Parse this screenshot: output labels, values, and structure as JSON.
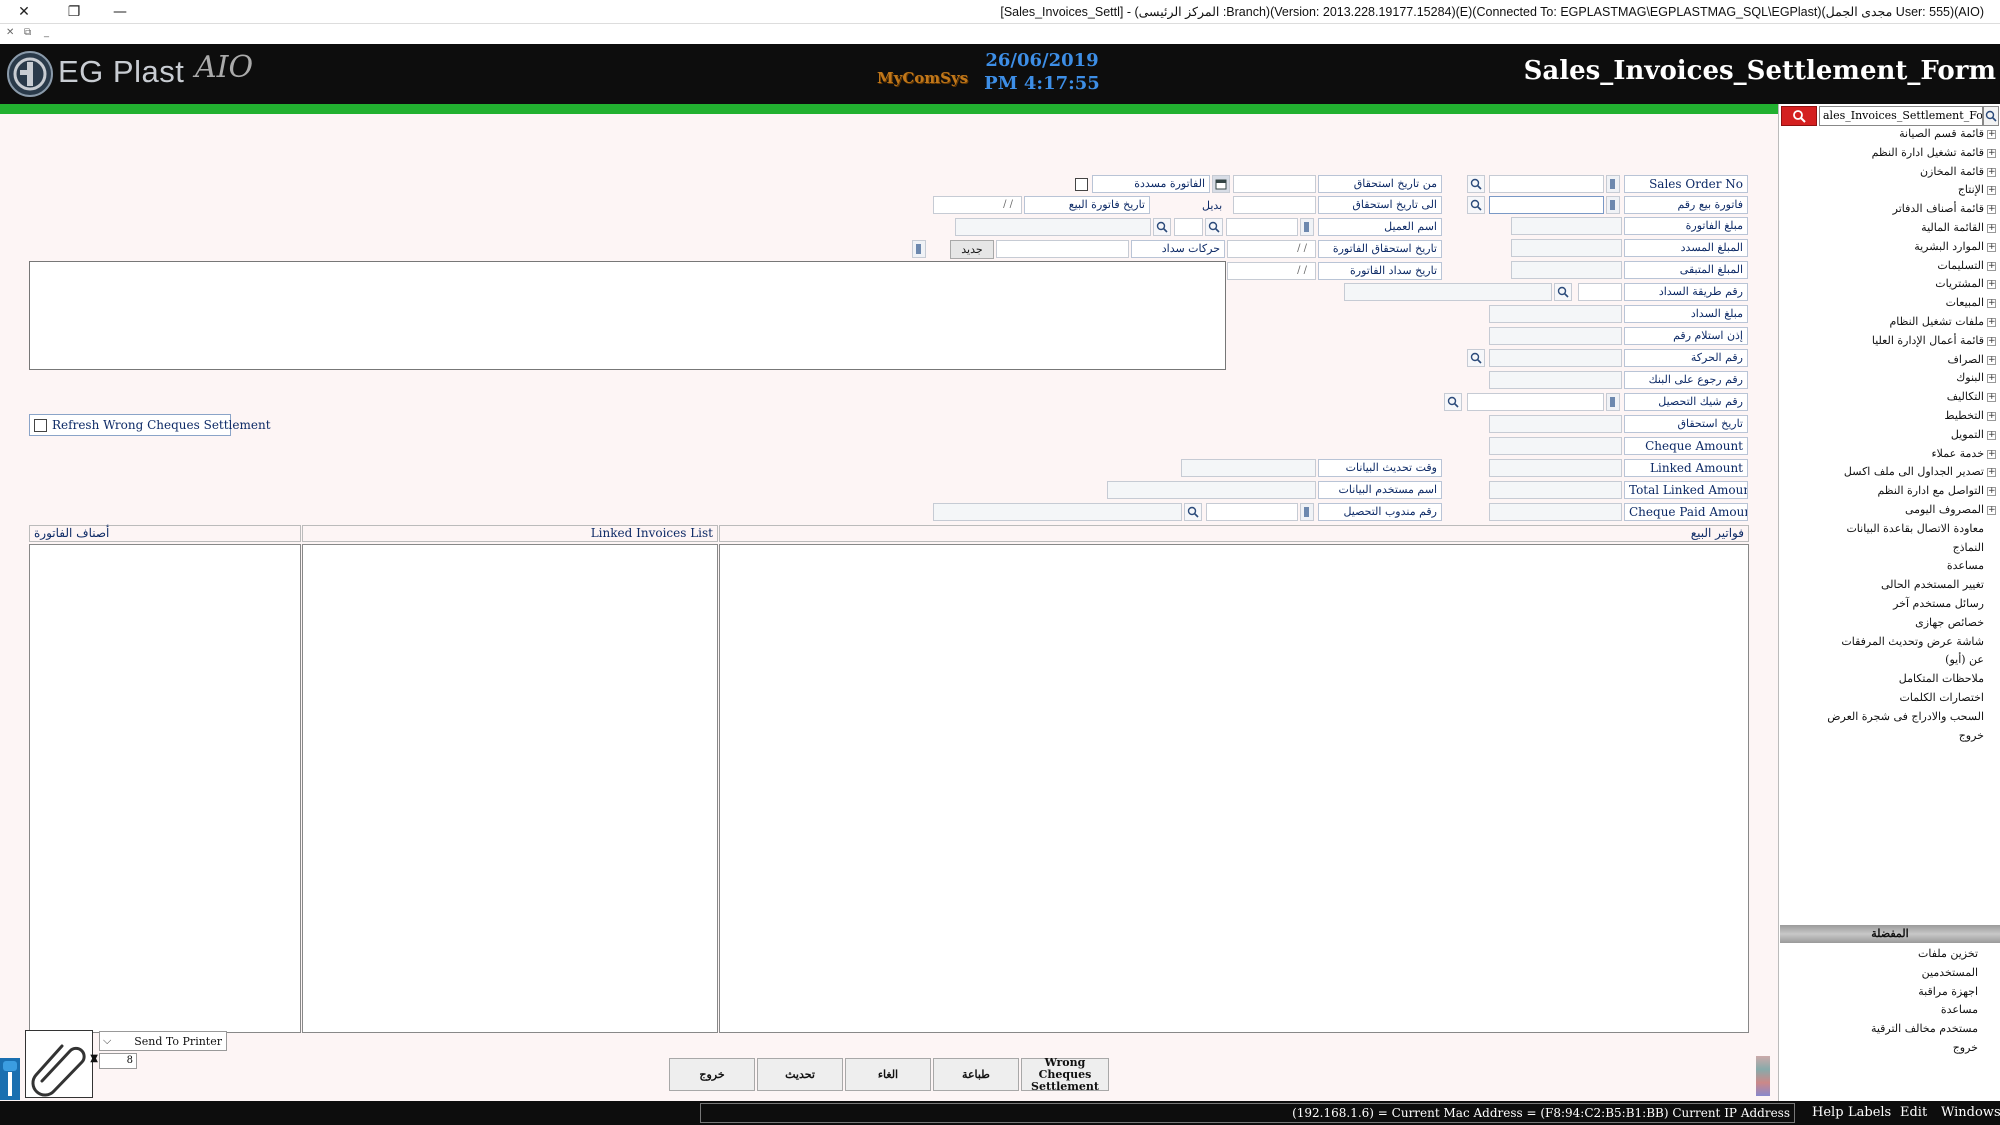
{
  "window": {
    "title": "[Sales_Invoices_Settl] - (المركز الرئيسى :Branch)(Version: 2013.228.19177.15284)(E)(Connected To: EGPLASTMAG\\EGPLASTMAG_SQL\\EGPlast)(مجدى الجمل User: 555)(AIO)",
    "close": "✕",
    "restore": "❐",
    "minimize": "—"
  },
  "subbar": {
    "close": "✕",
    "restore": "⧉",
    "minimize": "_"
  },
  "header": {
    "brand": "EG Plast",
    "aio": "AIO",
    "vendor": "MyComSys",
    "date": "26/06/2019",
    "time": "PM 4:17:55",
    "form_title": "Sales_Invoices_Settlement_Form"
  },
  "form": {
    "sales_order_no": "Sales Order No",
    "invoice_no": "فاتورة بيع رقم",
    "invoice_amount": "مبلغ الفاتورة",
    "paid_amount": "المبلغ المسدد",
    "remaining_amount": "المبلغ المتبقى",
    "payment_method_no": "رقم طريقة السداد",
    "payment_amount": "مبلغ السداد",
    "receipt_no": "إذن استلام رقم",
    "transaction_no": "رقم الحركة",
    "bank_return_no": "رقم رجوع على البنك",
    "collection_cheque_no": "رقم شيك التحصيل",
    "due_date": "تاريخ استحقاق",
    "cheque_amount": "Cheque Amount",
    "linked_amount": "Linked Amount",
    "total_linked_amount": "Total Linked Amount",
    "cheque_paid_amount": "Cheque Paid Amount",
    "from_due_date": "من تاريخ استحقاق",
    "to_due_date": "الى تاريخ استحقاق",
    "customer_name": "اسم العميل",
    "invoice_due_date": "تاريخ استحقاق الفاتورة",
    "invoice_payment_date": "تاريخ سداد الفاتورة",
    "paid_invoice": "الفاتورة مسددة",
    "alternative": "بديل",
    "sales_invoice_date": "تاريخ فاتورة البيع",
    "payment_movements": "حركات سداد",
    "new": "جديد",
    "data_update_time": "وقت تحديث البيانات",
    "data_user_name": "اسم مستخدم البيانات",
    "collection_rep_no": "رقم مندوب التحصيل",
    "date_placeholder": "/ /"
  },
  "refresh_wrong_cheques": "Refresh Wrong Cheques Settlement",
  "panels": {
    "invoice_items": "أصناف الفاتورة",
    "linked_invoices": "Linked Invoices List",
    "sales_invoices": "فواتير البيع"
  },
  "buttons": {
    "exit": "خروج",
    "refresh": "تحديث",
    "cancel": "الغاء",
    "print": "طباعة",
    "wrong_cheques_1": "Wrong Cheques",
    "wrong_cheques_2": "Settlement"
  },
  "printer": {
    "label": "Send To Printer",
    "copies": "8",
    "arrow": "⌵",
    "spin_up": "▲",
    "spin_down": "▼"
  },
  "sidebar": {
    "search_value": "ales_Invoices_Settlement_Form",
    "tree": [
      "قائمة قسم الصيانة",
      "قائمة تشغيل ادارة النظم",
      "قائمة المخازن",
      "الإنتاج",
      "قائمة أصناف الدفاتر",
      "القائمة المالية",
      "الموارد البشرية",
      "التسليمات",
      "المشتريات",
      "المبيعات",
      "ملفات تشغيل النظام",
      "قائمة أعمال الإدارة العليا",
      "الصراف",
      "البنوك",
      "التكاليف",
      "التخطيط",
      "التمويل",
      "خدمة عملاء",
      "تصدير الجداول الى ملف اكسل",
      "التواصل مع ادارة النظم",
      "المصروف اليومى",
      "معاودة الاتصال بقاعدة البيانات",
      "النماذج",
      "مساعدة",
      "تغيير المستخدم الحالى",
      "رسائل مستخدم آخر",
      "خصائص جهازى",
      "شاشة عرض وتحديث المرفقات",
      "عن (أيو)",
      "ملاحظات المتكامل",
      "اختصارات الكلمات",
      "السحب والادراج فى شجرة العرض",
      "خروج"
    ],
    "expandable_count": 21,
    "fav_header": "المفضلة",
    "fav": [
      "تخزين ملفات",
      "المستخدمين",
      "اجهزة مراقبة",
      "مساعدة",
      "مستخدم مخالف الترقية",
      "خروج"
    ]
  },
  "status": {
    "text": "(192.168.1.6) = Current Mac Address = (F8:94:C2:B5:B1:BB) Current IP Address",
    "menus": [
      "Help",
      "Labels",
      "Edit",
      "Windows"
    ]
  },
  "colors": {
    "accent_green": "#22b030",
    "header_bg": "#0d0d0d",
    "date_blue": "#3d8ee6",
    "search_red": "#d42020"
  }
}
